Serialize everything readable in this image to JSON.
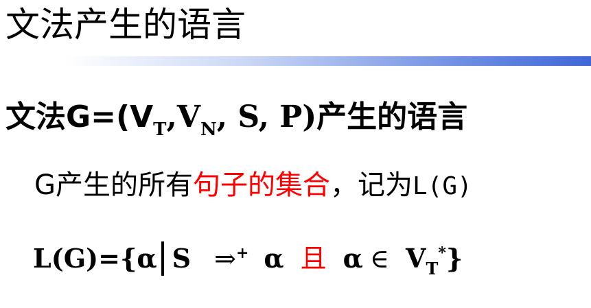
{
  "title": "文法产生的语言",
  "line1": {
    "prefix": "文法G=(V",
    "sub_t": "T",
    "comma1": ",V",
    "sub_n": "N",
    "rest": ", S, P)",
    "suffix": "产生的语言"
  },
  "line2": {
    "before": "G产生的所有",
    "highlight": "句子的集合",
    "punct": "，",
    "after": "记为",
    "notation": "L(G)"
  },
  "line3": {
    "start": "L(G)={α",
    "s": "S",
    "derive": "⇒",
    "plus": "+",
    "alpha1": "α",
    "conj": "且",
    "alpha2": "α",
    "in": "∈",
    "v": "V",
    "sub_t": "T",
    "star": "*",
    "close": "}"
  },
  "colors": {
    "highlight": "#ff0000",
    "title_bar_end": "#3f66d6"
  }
}
